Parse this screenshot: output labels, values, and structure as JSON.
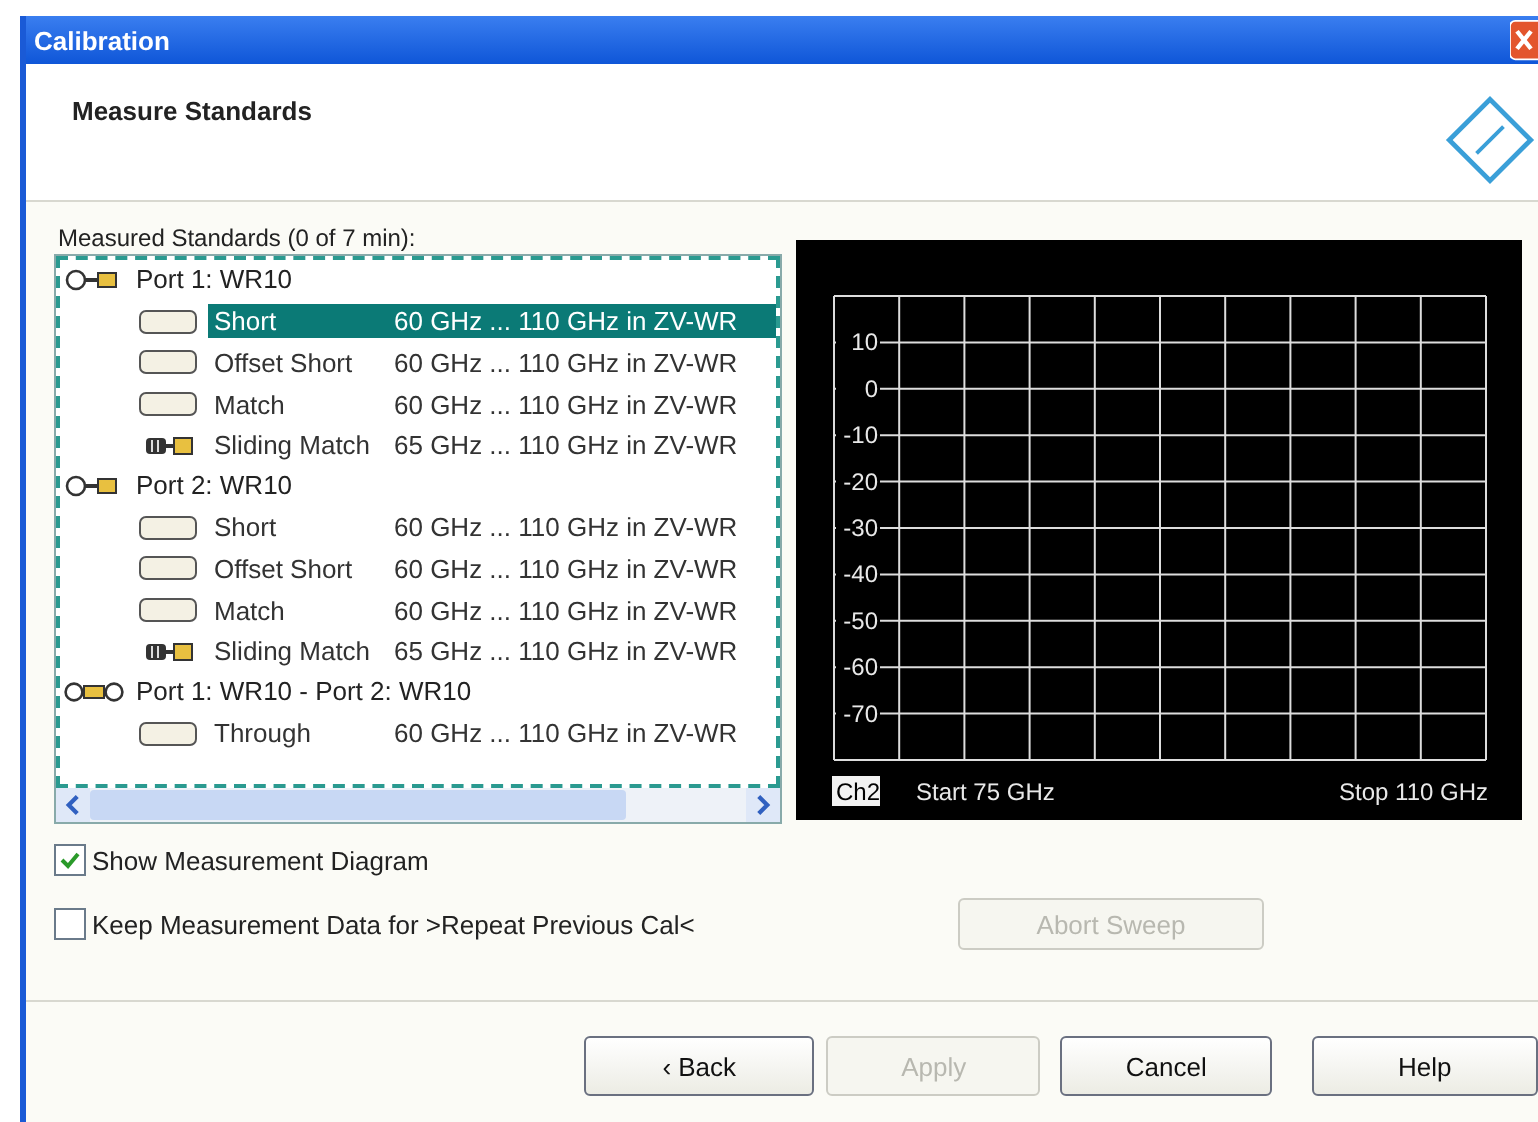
{
  "window": {
    "title": "Calibration"
  },
  "header": {
    "title": "Measure Standards"
  },
  "tree": {
    "label": "Measured Standards (0 of 7 min):",
    "groups": [
      {
        "name": "Port 1: WR10",
        "kind": "port",
        "children": [
          {
            "name": "Short",
            "range": "60 GHz ... 110 GHz  in ZV-WR",
            "kind": "standard",
            "selected": true
          },
          {
            "name": "Offset Short",
            "range": "60 GHz ... 110 GHz  in ZV-WR",
            "kind": "standard",
            "selected": false
          },
          {
            "name": "Match",
            "range": "60 GHz ... 110 GHz  in ZV-WR",
            "kind": "standard",
            "selected": false
          },
          {
            "name": "Sliding Match",
            "range": "65 GHz ... 110 GHz  in ZV-WR",
            "kind": "sliding",
            "selected": false
          }
        ]
      },
      {
        "name": "Port 2: WR10",
        "kind": "port",
        "children": [
          {
            "name": "Short",
            "range": "60 GHz ... 110 GHz  in ZV-WR",
            "kind": "standard",
            "selected": false
          },
          {
            "name": "Offset Short",
            "range": "60 GHz ... 110 GHz  in ZV-WR",
            "kind": "standard",
            "selected": false
          },
          {
            "name": "Match",
            "range": "60 GHz ... 110 GHz  in ZV-WR",
            "kind": "standard",
            "selected": false
          },
          {
            "name": "Sliding Match",
            "range": "65 GHz ... 110 GHz  in ZV-WR",
            "kind": "sliding",
            "selected": false
          }
        ]
      },
      {
        "name": "Port 1: WR10 - Port 2: WR10",
        "kind": "two_port",
        "children": [
          {
            "name": "Through",
            "range": "60 GHz ... 110 GHz  in ZV-WR",
            "kind": "standard",
            "selected": false
          }
        ]
      }
    ]
  },
  "diagram": {
    "y_labels": [
      "10",
      "0",
      "-10",
      "-20",
      "-30",
      "-40",
      "-50",
      "-60",
      "-70"
    ],
    "channel": "Ch2",
    "start": "Start 75 GHz",
    "stop": "Stop 110 GHz"
  },
  "options": [
    {
      "label": "Show Measurement Diagram",
      "checked": true
    },
    {
      "label": "Keep Measurement Data for >Repeat Previous Cal<",
      "checked": false
    }
  ],
  "abort_button": {
    "label": "Abort Sweep",
    "disabled": true
  },
  "buttons": [
    {
      "label": "‹ Back",
      "disabled": false
    },
    {
      "label": "Apply",
      "disabled": true
    },
    {
      "label": "Cancel",
      "disabled": false
    },
    {
      "label": "Help",
      "disabled": false
    }
  ]
}
